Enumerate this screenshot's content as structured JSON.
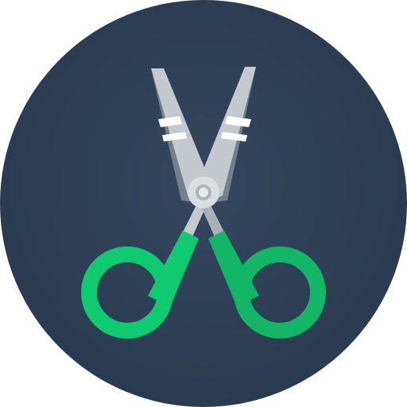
{
  "icon": {
    "name": "scissors-icon",
    "colors": {
      "background": "#2e4057",
      "background_edge": "#2a3b50",
      "blade_light": "#c3c9cc",
      "blade_shade": "#a9b1b5",
      "stripe": "#ffffff",
      "handle_left": "#0ecb6f",
      "handle_right": "#12b765",
      "pivot_ring": "#d9dee0",
      "pivot_center": "#aeb5b9"
    }
  }
}
